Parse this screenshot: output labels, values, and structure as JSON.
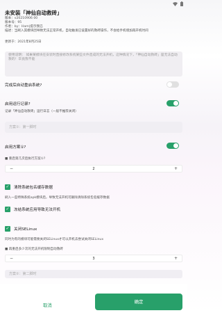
{
  "status_icons": [
    "wifi-icon",
    "battery-icon"
  ],
  "title": "未安装「神仙自动救砖」",
  "meta": [
    "版本：v20210906 00",
    "版本号：95",
    "作者：by：Ham|提示我已",
    "描述：当刷入其模块因导致无法正常开机，自动触发已设置好的救砖操作，不会给手机增加再开机时间",
    "。",
    "更新于：2021年8月25日"
  ],
  "usage": "使用说明：\n如果某模块在安装时直接修改系统某些文件造成的无法开机，这种情况下，「神仙自动救砖」是无法自动救的！毕竟我不能",
  "rows": {
    "auto_reboot": "完成后自动重启系统?",
    "enable_log": "启用运行记录?",
    "log_desc": "记录「神仙自动救砖」运行日志（一般不推荐关闭）",
    "plan_placeholder_1": "方案①：第一脚时",
    "enable_plan": "启用方案①?",
    "boot_times": "■ 重启第几次后执行方案①?",
    "boot_value": "2",
    "clear_cache": "清除系统包名缓存数据",
    "clear_cache_desc": "刷入一些特殊系统apk模块后，导致无法开机可删除清除系统包名缓存数据",
    "freeze": "冻结系统应用导致无法开机",
    "selinux": "关闭SELinux",
    "selinux_desc": "同时为有的模块可能需要关闭SELinux才可以开机去尝试关闭SELinux",
    "again": "■ 再重启多少次的无法开机限制自动救砖",
    "again_value": "3",
    "plan_placeholder_2": "方案②：第二脚时"
  },
  "footer": {
    "cancel": "取消",
    "ok": "确定"
  },
  "colors": {
    "accent": "#28a06a"
  }
}
